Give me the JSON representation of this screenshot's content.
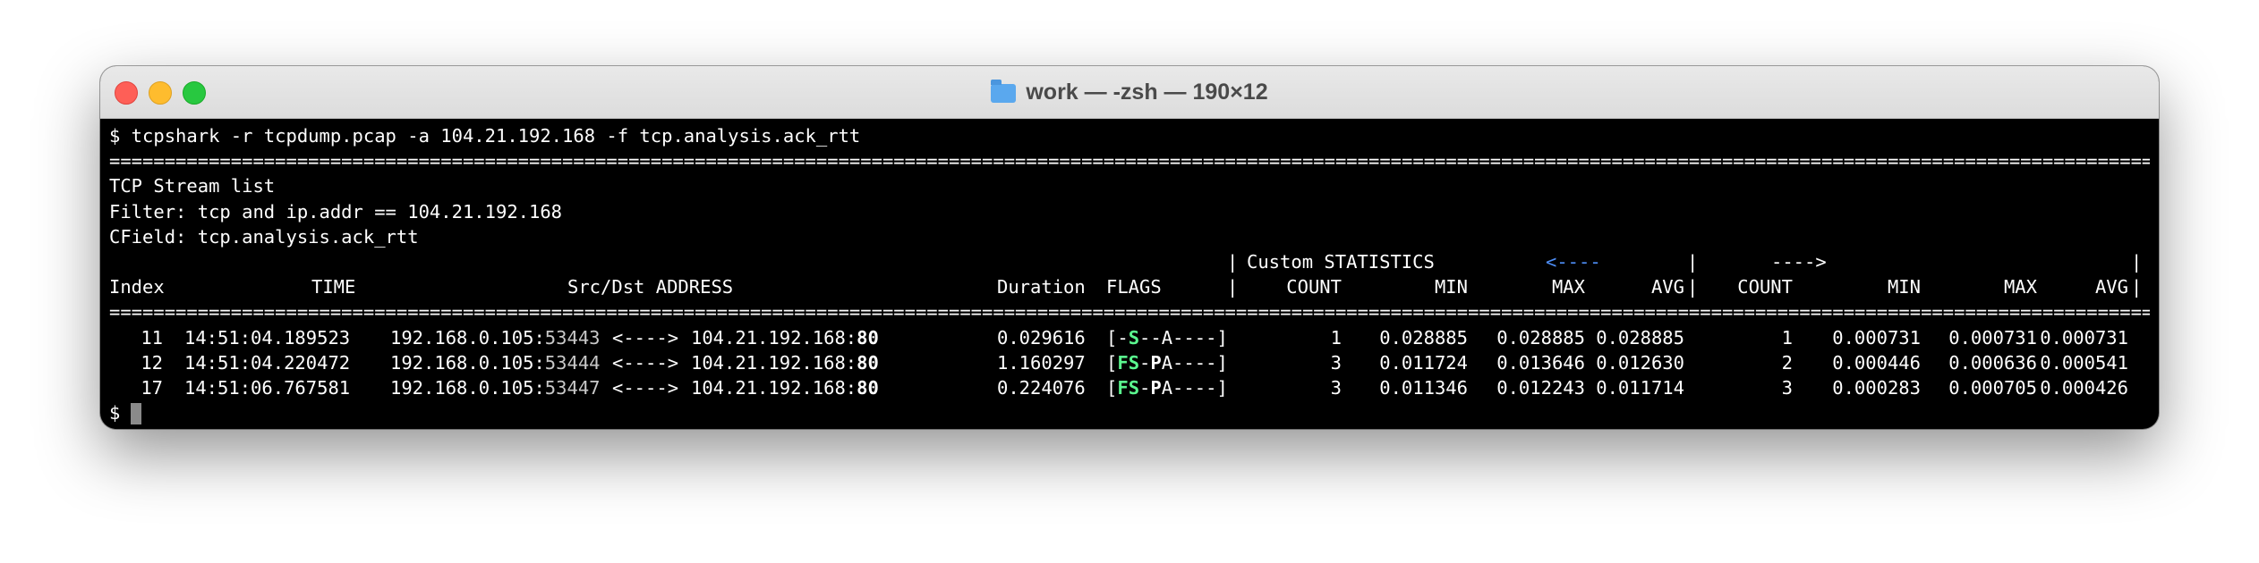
{
  "window": {
    "title": "work — -zsh — 190×12"
  },
  "terminal": {
    "command": "$ tcpshark -r tcpdump.pcap -a 104.21.192.168 -f tcp.analysis.ack_rtt",
    "separator": "================================================================================================================================================================================================================================================",
    "info": [
      "TCP Stream list",
      "Filter: tcp and ip.addr == 104.21.192.168",
      "CField: tcp.analysis.ack_rtt"
    ],
    "header1": {
      "bar1": "|",
      "custom": "Custom STATISTICS",
      "left_arrow": "<----",
      "bar2": "|",
      "right_arrow": "---->",
      "bar3": "|"
    },
    "header2": {
      "index": "Index",
      "time": "TIME",
      "addr": "Src/Dst ADDRESS",
      "duration": "Duration",
      "flags": "FLAGS",
      "bar1": "|",
      "count1": "COUNT",
      "min1": "MIN",
      "max1": "MAX",
      "avg1": "AVG",
      "bar2": "|",
      "count2": "COUNT",
      "min2": "MIN",
      "max2": "MAX",
      "avg2": "AVG",
      "bar3": "|"
    },
    "rows": [
      {
        "index": "11",
        "time": "14:51:04.189523",
        "src_ip": "192.168.0.105:",
        "src_port": "53443",
        "arrow": "<---->",
        "dst_ip": "104.21.192.168:",
        "dst_port": "80",
        "duration": "0.029616",
        "flags": {
          "open": "[",
          "p1": "-",
          "p2": "S",
          "p3": "--",
          "p4": "A",
          "p5": "----",
          "close": "]"
        },
        "count1": "1",
        "min1": "0.028885",
        "max1": "0.028885",
        "avg1": "0.028885",
        "count2": "1",
        "min2": "0.000731",
        "max2": "0.000731",
        "avg2": "0.000731"
      },
      {
        "index": "12",
        "time": "14:51:04.220472",
        "src_ip": "192.168.0.105:",
        "src_port": "53444",
        "arrow": "<---->",
        "dst_ip": "104.21.192.168:",
        "dst_port": "80",
        "duration": "1.160297",
        "flags": {
          "open": "[",
          "p1": "F",
          "p2": "S",
          "p3": "-",
          "p4": "P",
          "p5": "A----",
          "close": "]"
        },
        "count1": "3",
        "min1": "0.011724",
        "max1": "0.013646",
        "avg1": "0.012630",
        "count2": "2",
        "min2": "0.000446",
        "max2": "0.000636",
        "avg2": "0.000541"
      },
      {
        "index": "17",
        "time": "14:51:06.767581",
        "src_ip": "192.168.0.105:",
        "src_port": "53447",
        "arrow": "<---->",
        "dst_ip": "104.21.192.168:",
        "dst_port": "80",
        "duration": "0.224076",
        "flags": {
          "open": "[",
          "p1": "F",
          "p2": "S",
          "p3": "-",
          "p4": "P",
          "p5": "A----",
          "close": "]"
        },
        "count1": "3",
        "min1": "0.011346",
        "max1": "0.012243",
        "avg1": "0.011714",
        "count2": "3",
        "min2": "0.000283",
        "max2": "0.000705",
        "avg2": "0.000426"
      }
    ],
    "prompt": "$"
  },
  "colors": {
    "background": "#000000",
    "text": "#ffffff",
    "flag_highlight": "#5af78e",
    "arrow_blue": "#4e8ef7"
  }
}
